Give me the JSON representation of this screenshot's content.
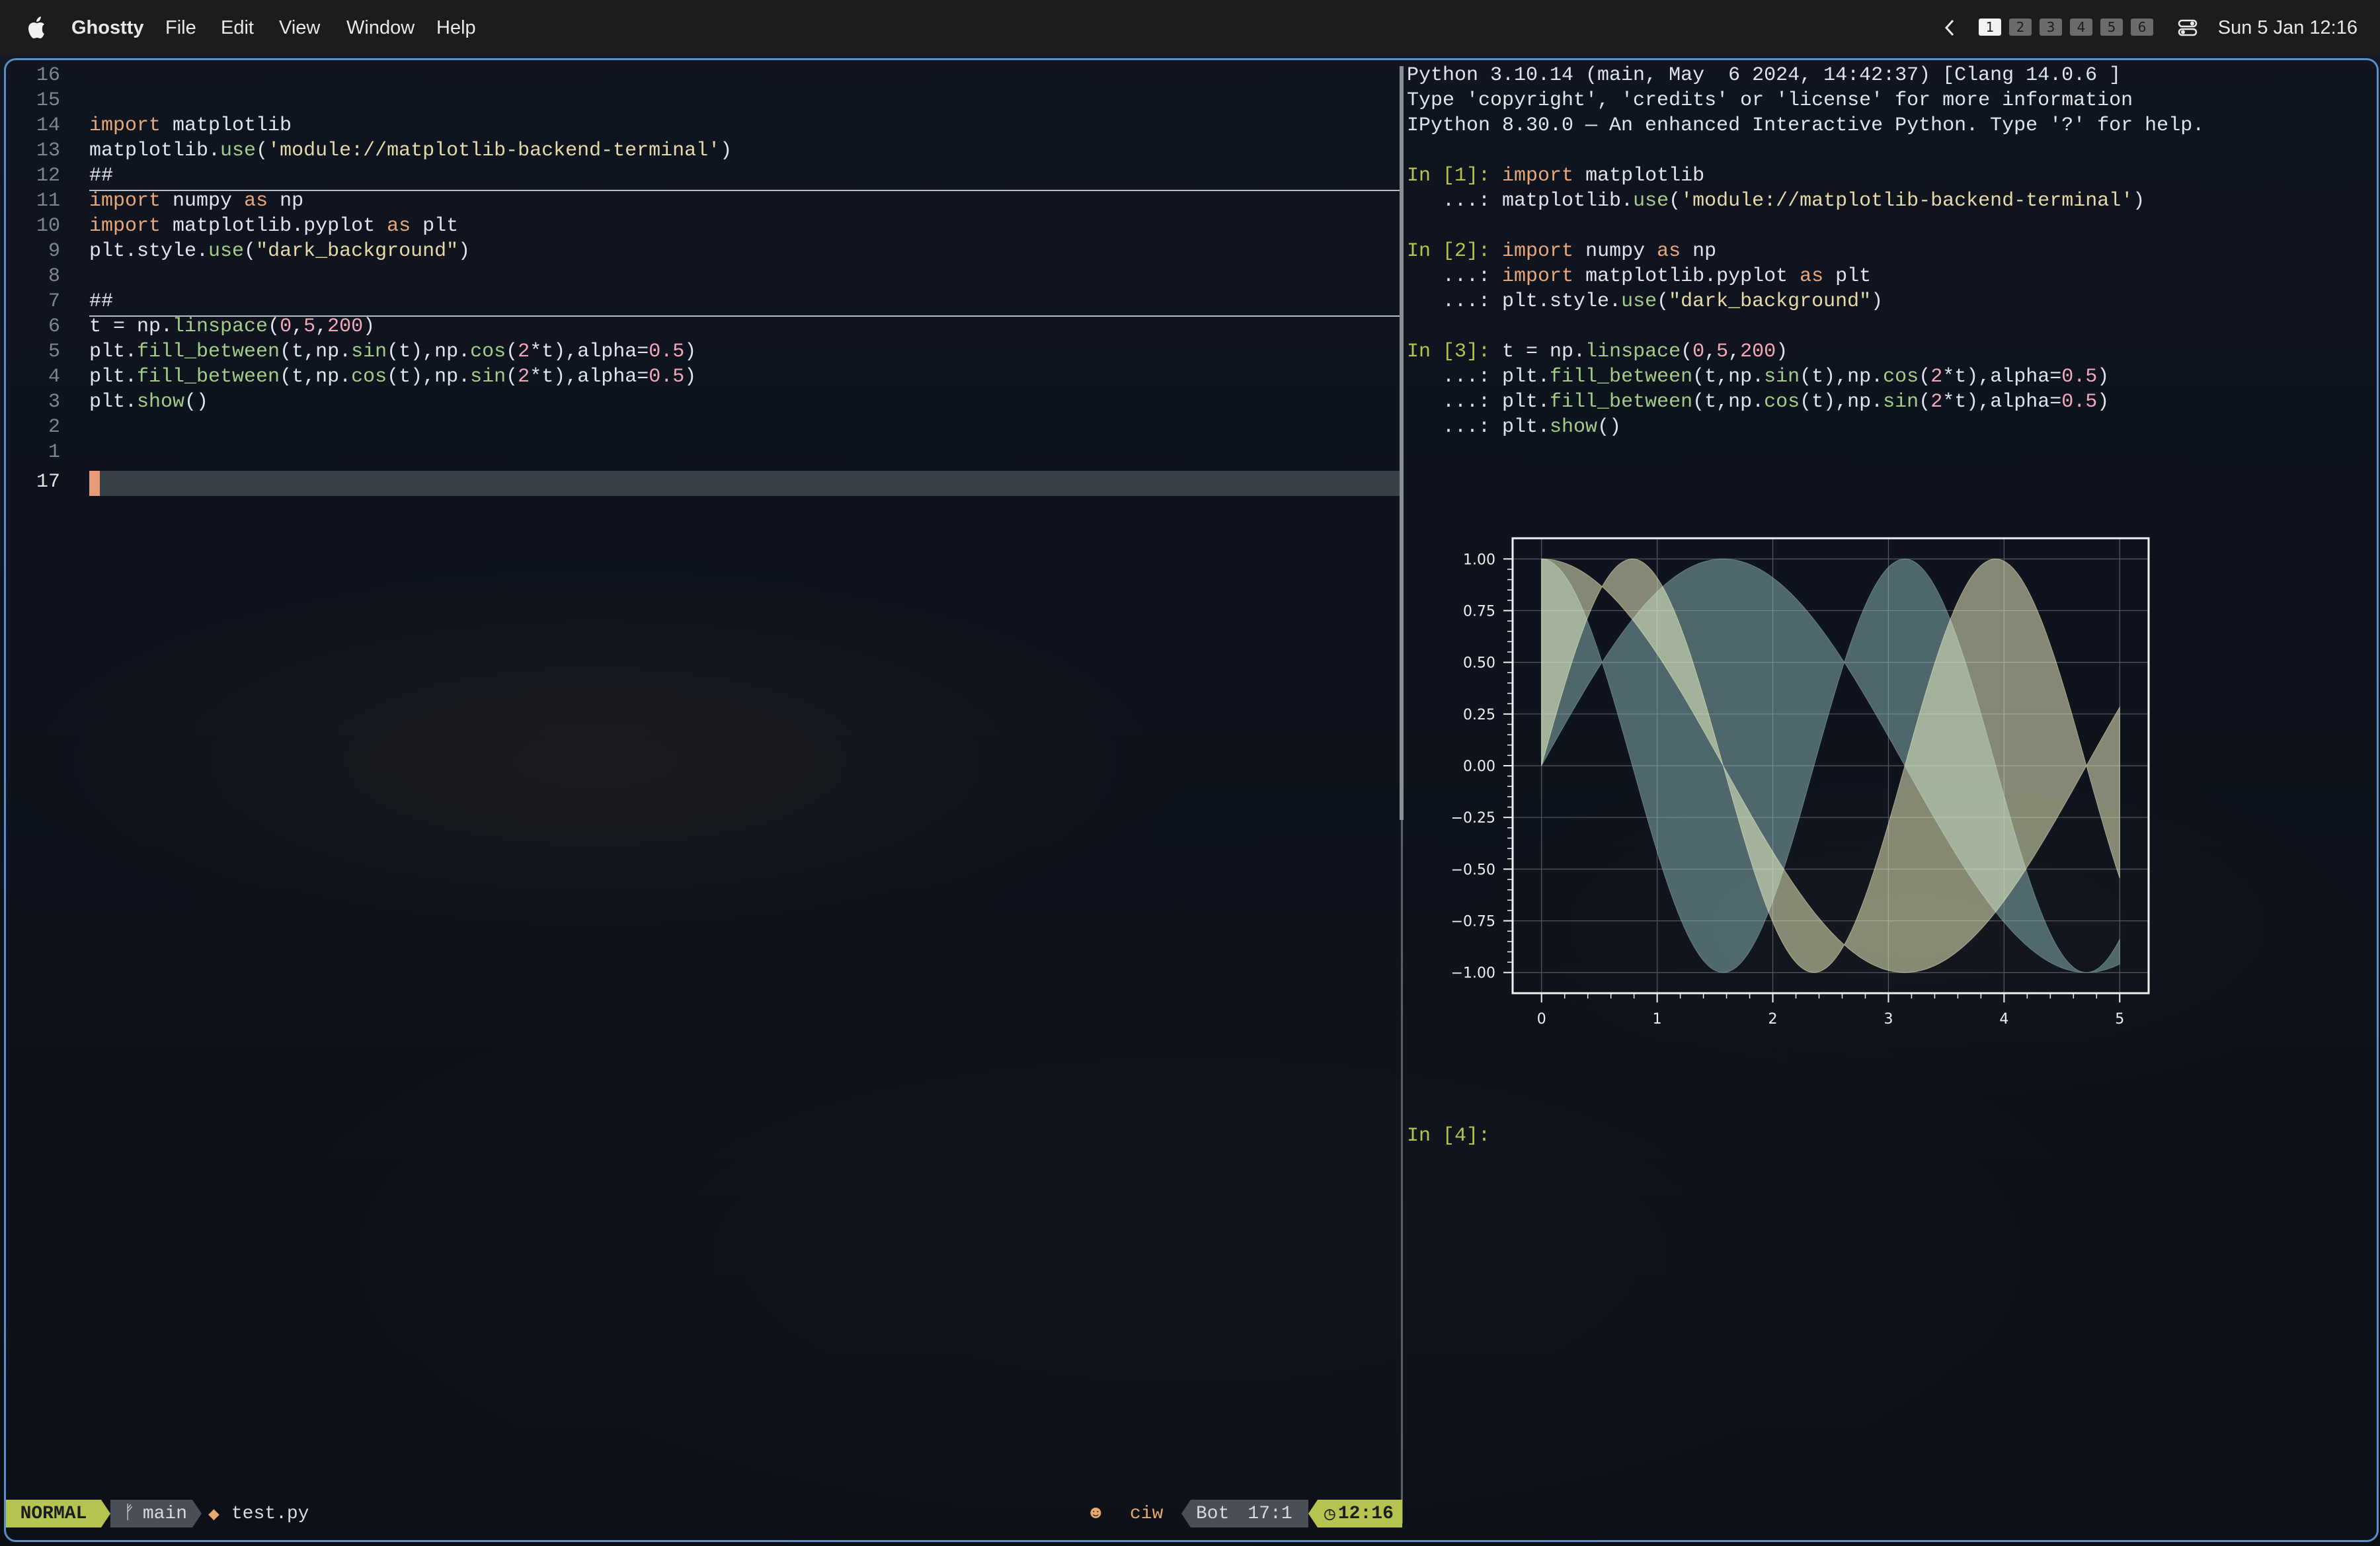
{
  "menubar": {
    "app_name": "Ghostty",
    "menus": [
      "File",
      "Edit",
      "View",
      "Window",
      "Help"
    ],
    "workspaces": [
      "1",
      "2",
      "3",
      "4",
      "5",
      "6"
    ],
    "active_workspace": "1",
    "clock": "Sun 5 Jan  12:16"
  },
  "editor": {
    "lines": [
      {
        "num": "16",
        "text": ""
      },
      {
        "num": "15",
        "text": ""
      },
      {
        "num": "14",
        "text": "import matplotlib"
      },
      {
        "num": "13",
        "text": "matplotlib.use('module://matplotlib-backend-terminal')"
      },
      {
        "num": "12",
        "text": "##"
      },
      {
        "num": "11",
        "text": "import numpy as np"
      },
      {
        "num": "10",
        "text": "import matplotlib.pyplot as plt"
      },
      {
        "num": "9",
        "text": "plt.style.use(\"dark_background\")"
      },
      {
        "num": "8",
        "text": ""
      },
      {
        "num": "7",
        "text": "##"
      },
      {
        "num": "6",
        "text": "t = np.linspace(0,5,200)"
      },
      {
        "num": "5",
        "text": "plt.fill_between(t,np.sin(t),np.cos(2*t),alpha=0.5)"
      },
      {
        "num": "4",
        "text": "plt.fill_between(t,np.cos(t),np.sin(2*t),alpha=0.5)"
      },
      {
        "num": "3",
        "text": "plt.show()"
      },
      {
        "num": "2",
        "text": ""
      },
      {
        "num": "1",
        "text": ""
      },
      {
        "num": "17",
        "text": ""
      }
    ]
  },
  "statusline": {
    "mode": "NORMAL",
    "branch": "main",
    "file": "test.py",
    "pending": "ciw",
    "position_label": "Bot",
    "cursor_pos": "17:1",
    "time": "12:16"
  },
  "repl": {
    "header": [
      "Python 3.10.14 (main, May  6 2024, 14:42:37) [Clang 14.0.6 ]",
      "Type 'copyright', 'credits' or 'license' for more information",
      "IPython 8.30.0 — An enhanced Interactive Python. Type '?' for help."
    ],
    "cells": [
      {
        "prompt": "In [1]: ",
        "lines": [
          "import matplotlib",
          "matplotlib.use('module://matplotlib-backend-terminal')"
        ]
      },
      {
        "prompt": "In [2]: ",
        "lines": [
          "import numpy as np",
          "import matplotlib.pyplot as plt",
          "plt.style.use(\"dark_background\")"
        ]
      },
      {
        "prompt": "In [3]: ",
        "lines": [
          "t = np.linspace(0,5,200)",
          "plt.fill_between(t,np.sin(t),np.cos(2*t),alpha=0.5)",
          "plt.fill_between(t,np.cos(t),np.sin(2*t),alpha=0.5)",
          "plt.show()"
        ]
      }
    ],
    "continuation": "   ...: ",
    "next_prompt": "In [4]: "
  },
  "chart_data": {
    "type": "area",
    "x_range": [
      0,
      5
    ],
    "ylim": [
      -1.0,
      1.0
    ],
    "xticks": [
      "0",
      "1",
      "2",
      "3",
      "4",
      "5"
    ],
    "yticks": [
      "1.00",
      "0.75",
      "0.50",
      "0.25",
      "0.00",
      "−0.25",
      "−0.50",
      "−0.75",
      "−1.00"
    ],
    "grid": true,
    "series": [
      {
        "lower": "sin(t)",
        "upper": "cos(2t)",
        "alpha": 0.5,
        "color": "#8fbcbb",
        "x": [
          0,
          0.5,
          1,
          1.5,
          2,
          2.5,
          3,
          3.5,
          4,
          4.5,
          5
        ],
        "y1": [
          0,
          0.479,
          0.841,
          0.997,
          0.909,
          0.598,
          0.141,
          -0.351,
          -0.757,
          -0.978,
          -0.959
        ],
        "y2": [
          1,
          0.54,
          -0.416,
          -0.99,
          -0.654,
          0.284,
          0.96,
          0.754,
          -0.146,
          -0.911,
          -0.839
        ]
      },
      {
        "lower": "cos(t)",
        "upper": "sin(2t)",
        "alpha": 0.5,
        "color": "#fafdcb",
        "x": [
          0,
          0.5,
          1,
          1.5,
          2,
          2.5,
          3,
          3.5,
          4,
          4.5,
          5
        ],
        "y1": [
          1,
          0.878,
          0.54,
          0.071,
          -0.416,
          -0.801,
          -0.99,
          -0.936,
          -0.654,
          -0.211,
          0.284
        ],
        "y2": [
          0,
          0.841,
          0.909,
          0.141,
          -0.757,
          -0.959,
          -0.279,
          0.657,
          0.989,
          0.412,
          -0.544
        ]
      }
    ]
  }
}
